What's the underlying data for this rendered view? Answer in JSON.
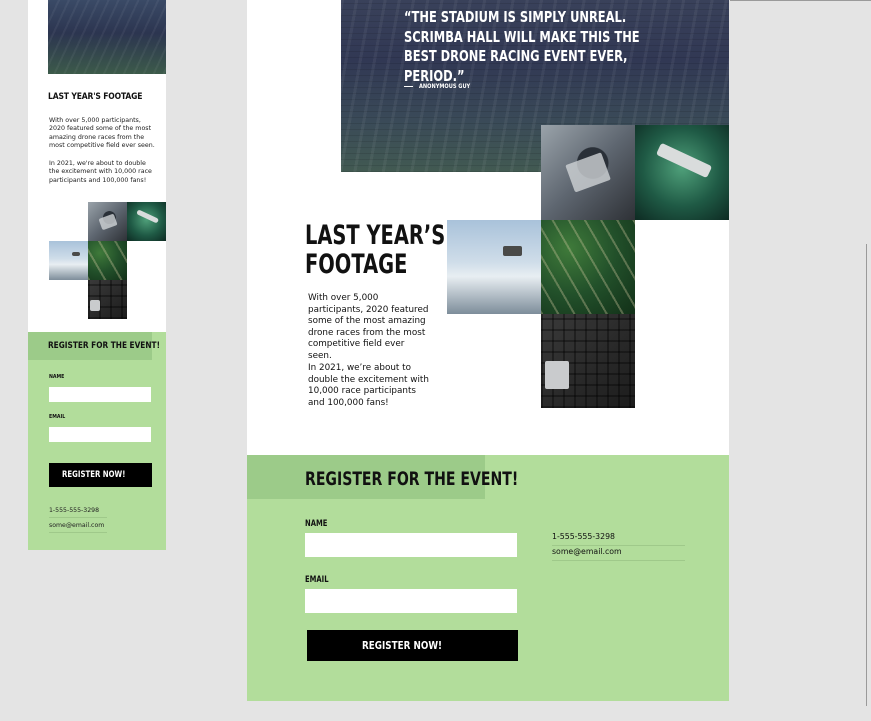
{
  "mobile": {
    "section_title": "LAST YEAR'S FOOTAGE",
    "paragraph_1": "With over 5,000 participants, 2020 featured some of the most amazing drone races from the most competitive field ever seen.",
    "paragraph_2": "In 2021, we're about to double the excitement with 10,000 race participants and 100,000 fans!",
    "register": {
      "title": "REGISTER FOR THE EVENT!",
      "name_label": "NAME",
      "email_label": "EMAIL",
      "button_label": "REGISTER NOW!",
      "phone": "1-555-555-3298",
      "email": "some@email.com"
    }
  },
  "desktop": {
    "quote": "“THE STADIUM IS SIMPLY UNREAL. SCRIMBA HALL WILL MAKE THIS THE BEST DRONE RACING EVENT EVER, PERIOD.”",
    "quote_author": "ANONYMOUS GUY",
    "section_title": "LAST YEAR’S FOOTAGE",
    "paragraph_1": "With over 5,000 participants, 2020 featured some of the most amazing drone races from the most competitive field ever seen.",
    "paragraph_2": "In 2021, we’re about to double the excitement with 10,000 race participants and 100,000 fans!",
    "register": {
      "title": "REGISTER FOR THE EVENT!",
      "name_label": "NAME",
      "email_label": "EMAIL",
      "button_label": "REGISTER NOW!",
      "phone": "1-555-555-3298",
      "email": "some@email.com"
    }
  },
  "colors": {
    "register_bg": "#b2dd9b",
    "register_header_bg": "#9ccb89",
    "button_bg": "#000000",
    "hero_overlay": "#313854"
  },
  "images": [
    "stadium-image",
    "hands-controller-image",
    "drone-green-image",
    "drone-sky-image",
    "forest-road-image",
    "drone-gear-flatlay-image"
  ]
}
